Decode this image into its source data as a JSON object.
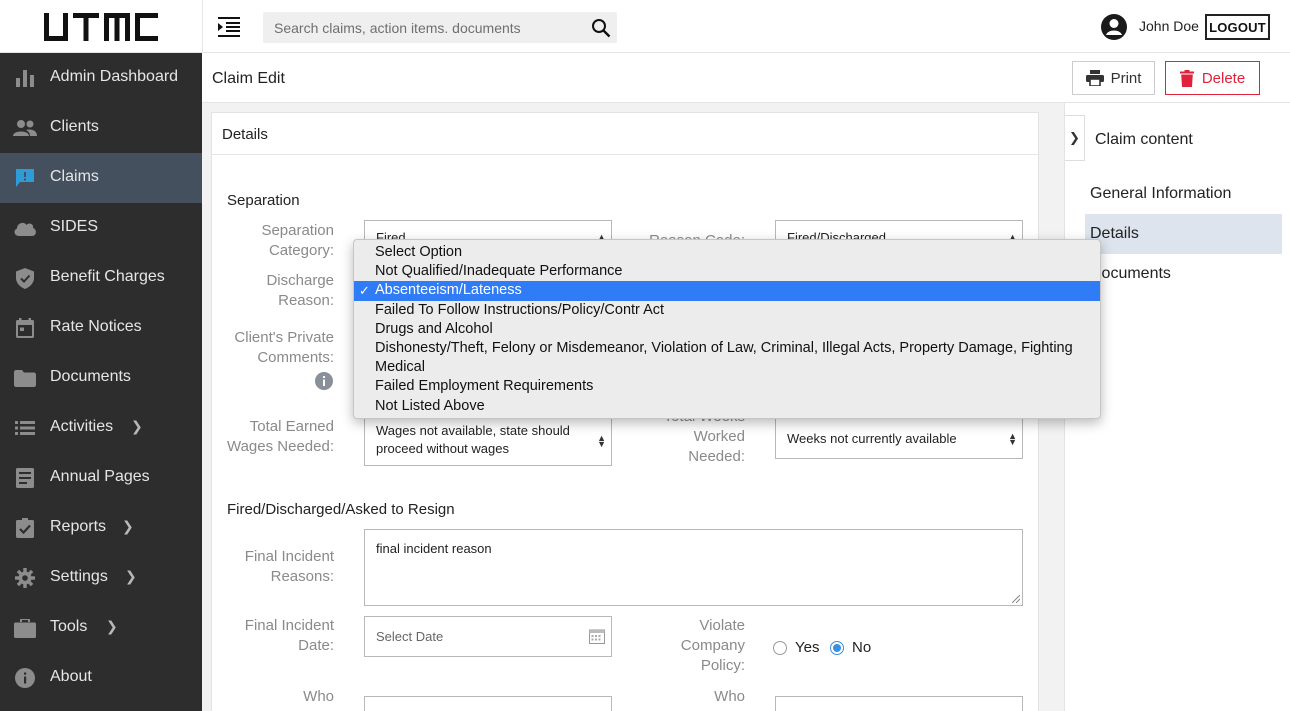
{
  "header": {
    "logo_text": "UTMC",
    "search_placeholder": "Search claims, action items. documents",
    "user_name": "John Doe",
    "logout_label": "LOGOUT"
  },
  "sidebar": {
    "items": [
      {
        "label": "Admin Dashboard",
        "icon": "bar-chart-icon"
      },
      {
        "label": "Clients",
        "icon": "people-icon"
      },
      {
        "label": "Claims",
        "icon": "chat-bubble-icon",
        "active": true
      },
      {
        "label": "SIDES",
        "icon": "cloud-icon"
      },
      {
        "label": "Benefit Charges",
        "icon": "shield-icon"
      },
      {
        "label": "Rate Notices",
        "icon": "calendar-icon"
      },
      {
        "label": "Documents",
        "icon": "folder-icon"
      },
      {
        "label": "Activities",
        "icon": "list-icon",
        "has_submenu": true
      },
      {
        "label": "Annual Pages",
        "icon": "document-icon"
      },
      {
        "label": "Reports",
        "icon": "checkbox-icon",
        "has_submenu": true
      },
      {
        "label": "Settings",
        "icon": "gear-icon",
        "has_submenu": true
      },
      {
        "label": "Tools",
        "icon": "briefcase-icon",
        "has_submenu": true
      },
      {
        "label": "About",
        "icon": "info-icon"
      }
    ]
  },
  "page": {
    "title": "Claim Edit",
    "print_label": "Print",
    "delete_label": "Delete"
  },
  "card": {
    "title": "Details",
    "separation": {
      "section_title": "Separation",
      "category_label": "Separation Category:",
      "category_value": "Fired",
      "reason_code_label": "Reason Code:",
      "reason_code_value": "Fired/Discharged",
      "discharge_reason_label": "Discharge Reason:",
      "private_comments_label": "Client's Private Comments:",
      "earned_wages_label": "Total Earned Wages Needed:",
      "earned_wages_value": "Wages not available, state should proceed without wages",
      "weeks_worked_label": "Total Weeks Worked Needed:",
      "weeks_worked_value": "Weeks not currently available"
    },
    "fired": {
      "section_title": "Fired/Discharged/Asked to Resign",
      "final_reasons_label": "Final Incident Reasons:",
      "final_reasons_value": "final incident reason",
      "final_date_label": "Final Incident Date:",
      "final_date_placeholder": "Select Date",
      "violate_label": "Violate Company Policy:",
      "yes_label": "Yes",
      "no_label": "No",
      "selected": "No",
      "who_label_1": "Who",
      "who_label_2": "Who"
    }
  },
  "right_panel": {
    "title": "Claim content",
    "items": [
      {
        "label": "General Information"
      },
      {
        "label": "Details",
        "active": true
      },
      {
        "label": "Documents"
      }
    ]
  },
  "discharge_dropdown": {
    "options": [
      "Select Option",
      "Not Qualified/Inadequate Performance",
      "Absenteeism/Lateness",
      "Failed To Follow Instructions/Policy/Contr Act",
      "Drugs and Alcohol",
      "Dishonesty/Theft, Felony or Misdemeanor, Violation of Law, Criminal, Illegal Acts, Property Damage, Fighting",
      "Medical",
      "Failed Employment Requirements",
      "Not Listed Above"
    ],
    "selected_index": 2
  },
  "colors": {
    "sidebar_bg": "#2d2d2d",
    "sidebar_active": "#44505e",
    "delete_red": "#e0233a",
    "dropdown_highlight": "#2f7cf6",
    "radio_blue": "#3b8fe0",
    "panel_active": "#dde4ee"
  }
}
